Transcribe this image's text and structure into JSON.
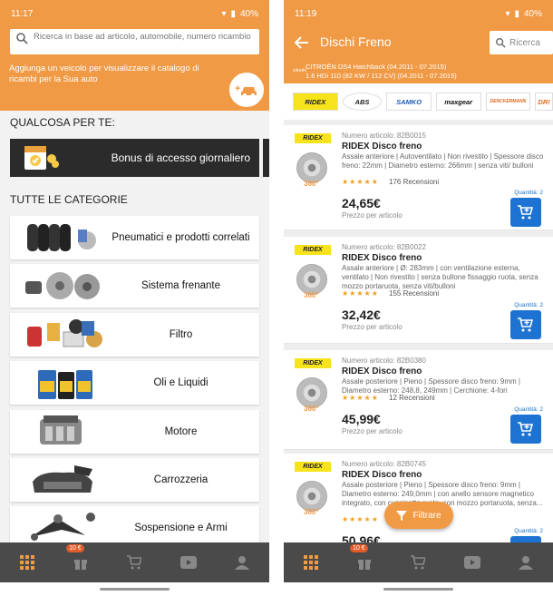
{
  "left": {
    "status_time": "11:17",
    "battery": "40%",
    "search_placeholder": "Ricerca in base ad articolo, automobile, numero ricambio",
    "promo_text": "Aggiunga un veicolo per visualizzare il catalogo di ricambi per la Sua auto",
    "section_for_you": "QUALCOSA PER TE:",
    "bonus_label": "Bonus di accesso giornaliero",
    "section_categories": "TUTTE LE CATEGORIE",
    "categories": [
      {
        "label": "Pneumatici e prodotti correlati",
        "icon": "tires-icon"
      },
      {
        "label": "Sistema frenante",
        "icon": "brakes-icon"
      },
      {
        "label": "Filtro",
        "icon": "filter-icon"
      },
      {
        "label": "Oli e Liquidi",
        "icon": "oil-icon"
      },
      {
        "label": "Motore",
        "icon": "engine-icon"
      },
      {
        "label": "Carrozzeria",
        "icon": "bodywork-icon"
      },
      {
        "label": "Sospensione e Armi",
        "icon": "suspension-icon"
      }
    ],
    "nav_badge": "10 €"
  },
  "right": {
    "status_time": "11:19",
    "battery": "40%",
    "title": "Dischi Freno",
    "search_label": "Ricerca",
    "vehicle_logo": "citroën",
    "vehicle_line1": "CITROËN DS4 Hatchback (04.2011 - 07.2015)",
    "vehicle_line2": "1.6 HDi 110 (82 KW / 112 CV) (04.2011 - 07.2015)",
    "brands": [
      "RIDEX",
      "ABS",
      "SAMKO",
      "maxgear",
      "DENCKERMANN",
      "DR!"
    ],
    "products": [
      {
        "logo": "RIDEX",
        "number": "Numero articolo: 82B0015",
        "name": "RIDEX Disco freno",
        "desc": "Assale anteriore | Autoventilato | Non rivestito | Spessore disco freno: 22mm | Diametro esterno: 266mm | senza viti/ bulloni",
        "stars": "★★★★★",
        "reviews": "176 Recensioni",
        "price": "24,65€",
        "per": "Prezzo per articolo",
        "qty": "Quantità: 2"
      },
      {
        "logo": "RIDEX",
        "number": "Numero articolo: 82B0022",
        "name": "RIDEX Disco freno",
        "desc": "Assale anteriore | Ø: 283mm | con ventilazione esterna, ventilato | Non rivestito | senza bullone fissaggio ruota, senza mozzo portaruota, senza viti/bulloni",
        "stars": "★★★★★",
        "reviews": "155 Recensioni",
        "price": "32,42€",
        "per": "Prezzo per articolo",
        "qty": "Quantità: 2"
      },
      {
        "logo": "RIDEX",
        "number": "Numero articolo: 82B0380",
        "name": "RIDEX Disco freno",
        "desc": "Assale posteriore | Pieno | Spessore disco freno: 9mm | Diametro esterno: 248,8, 249mm | Cerchione: 4-fori",
        "stars": "★★★★★",
        "reviews": "12 Recensioni",
        "price": "45,99€",
        "per": "Prezzo per articolo",
        "qty": "Quantità: 2"
      },
      {
        "logo": "RIDEX",
        "number": "Numero articolo: 82B0745",
        "name": "RIDEX Disco freno",
        "desc": "Assale posteriore | Pieno | Spessore disco freno: 9mm | Diametro esterno: 249,0mm | con anello sensore magnetico integrato, con cuscinetto ruota, con mozzo portaruota, senza...",
        "stars": "★★★★★",
        "reviews": "",
        "price": "50,96€",
        "per": "",
        "qty": "Quantità: 2"
      }
    ],
    "filter_label": "Filtrare",
    "nav_badge": "10 €"
  },
  "colors": {
    "accent": "#f19a45",
    "cart": "#1e73d2",
    "nav": "#4a4a4a"
  }
}
